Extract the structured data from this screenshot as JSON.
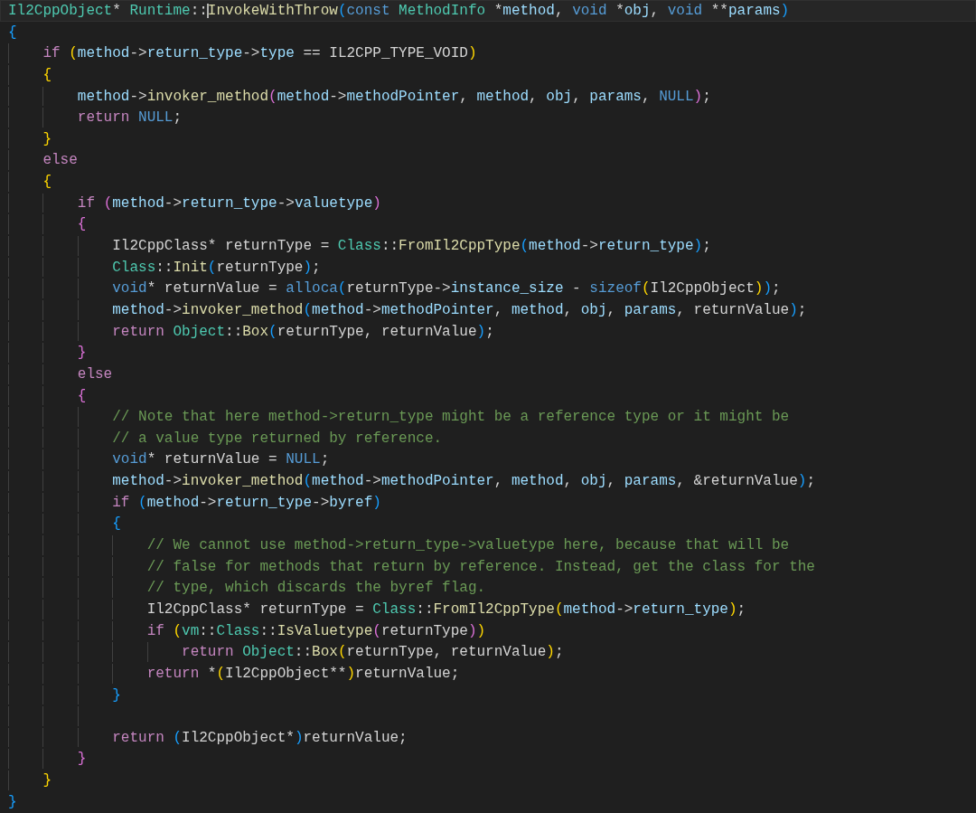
{
  "editor": {
    "lines": [
      {
        "current": true,
        "tokens": [
          {
            "text": "Il2CppObject",
            "kind": "type"
          },
          {
            "text": "* ",
            "kind": "plain"
          },
          {
            "text": "Runtime",
            "kind": "type"
          },
          {
            "text": "::",
            "kind": "plain"
          },
          {
            "text": "InvokeWithThrow",
            "kind": "func",
            "cursor_before": true
          },
          {
            "text": "(",
            "kind": "b0"
          },
          {
            "text": "const ",
            "kind": "storage"
          },
          {
            "text": "MethodInfo",
            "kind": "type"
          },
          {
            "text": " *",
            "kind": "plain"
          },
          {
            "text": "method",
            "kind": "var"
          },
          {
            "text": ", ",
            "kind": "plain"
          },
          {
            "text": "void",
            "kind": "storage"
          },
          {
            "text": " *",
            "kind": "plain"
          },
          {
            "text": "obj",
            "kind": "var"
          },
          {
            "text": ", ",
            "kind": "plain"
          },
          {
            "text": "void",
            "kind": "storage"
          },
          {
            "text": " **",
            "kind": "plain"
          },
          {
            "text": "params",
            "kind": "var"
          },
          {
            "text": ")",
            "kind": "b0"
          }
        ]
      },
      {
        "current": false,
        "tokens": [
          {
            "text": "{",
            "kind": "b0"
          }
        ]
      },
      {
        "current": false,
        "tokens": [
          {
            "text": "    if ",
            "kind": "kw"
          },
          {
            "text": "(",
            "kind": "b1"
          },
          {
            "text": "method",
            "kind": "var"
          },
          {
            "text": "->",
            "kind": "plain"
          },
          {
            "text": "return_type",
            "kind": "var"
          },
          {
            "text": "->",
            "kind": "plain"
          },
          {
            "text": "type",
            "kind": "var"
          },
          {
            "text": " == IL2CPP_TYPE_VOID",
            "kind": "plain"
          },
          {
            "text": ")",
            "kind": "b1"
          }
        ]
      },
      {
        "current": false,
        "tokens": [
          {
            "text": "    {",
            "kind": "b1"
          }
        ]
      },
      {
        "current": false,
        "tokens": [
          {
            "text": "        method",
            "kind": "var"
          },
          {
            "text": "->",
            "kind": "plain"
          },
          {
            "text": "invoker_method",
            "kind": "func"
          },
          {
            "text": "(",
            "kind": "b2"
          },
          {
            "text": "method",
            "kind": "var"
          },
          {
            "text": "->",
            "kind": "plain"
          },
          {
            "text": "methodPointer",
            "kind": "var"
          },
          {
            "text": ", ",
            "kind": "plain"
          },
          {
            "text": "method",
            "kind": "var"
          },
          {
            "text": ", ",
            "kind": "plain"
          },
          {
            "text": "obj",
            "kind": "var"
          },
          {
            "text": ", ",
            "kind": "plain"
          },
          {
            "text": "params",
            "kind": "var"
          },
          {
            "text": ", ",
            "kind": "plain"
          },
          {
            "text": "NULL",
            "kind": "storage"
          },
          {
            "text": ")",
            "kind": "b2"
          },
          {
            "text": ";",
            "kind": "plain"
          }
        ]
      },
      {
        "current": false,
        "tokens": [
          {
            "text": "        return ",
            "kind": "kw"
          },
          {
            "text": "NULL",
            "kind": "storage"
          },
          {
            "text": ";",
            "kind": "plain"
          }
        ]
      },
      {
        "current": false,
        "tokens": [
          {
            "text": "    }",
            "kind": "b1"
          }
        ]
      },
      {
        "current": false,
        "tokens": [
          {
            "text": "    else",
            "kind": "kw"
          }
        ]
      },
      {
        "current": false,
        "tokens": [
          {
            "text": "    {",
            "kind": "b1"
          }
        ]
      },
      {
        "current": false,
        "tokens": [
          {
            "text": "        if ",
            "kind": "kw"
          },
          {
            "text": "(",
            "kind": "b2"
          },
          {
            "text": "method",
            "kind": "var"
          },
          {
            "text": "->",
            "kind": "plain"
          },
          {
            "text": "return_type",
            "kind": "var"
          },
          {
            "text": "->",
            "kind": "plain"
          },
          {
            "text": "valuetype",
            "kind": "var"
          },
          {
            "text": ")",
            "kind": "b2"
          }
        ]
      },
      {
        "current": false,
        "tokens": [
          {
            "text": "        {",
            "kind": "b2"
          }
        ]
      },
      {
        "current": false,
        "tokens": [
          {
            "text": "            Il2CppClass* returnType = ",
            "kind": "plain"
          },
          {
            "text": "Class",
            "kind": "type"
          },
          {
            "text": "::",
            "kind": "plain"
          },
          {
            "text": "FromIl2CppType",
            "kind": "func"
          },
          {
            "text": "(",
            "kind": "b0"
          },
          {
            "text": "method",
            "kind": "var"
          },
          {
            "text": "->",
            "kind": "plain"
          },
          {
            "text": "return_type",
            "kind": "var"
          },
          {
            "text": ")",
            "kind": "b0"
          },
          {
            "text": ";",
            "kind": "plain"
          }
        ]
      },
      {
        "current": false,
        "tokens": [
          {
            "text": "            Class",
            "kind": "type"
          },
          {
            "text": "::",
            "kind": "plain"
          },
          {
            "text": "Init",
            "kind": "func"
          },
          {
            "text": "(",
            "kind": "b0"
          },
          {
            "text": "returnType",
            "kind": "plain"
          },
          {
            "text": ")",
            "kind": "b0"
          },
          {
            "text": ";",
            "kind": "plain"
          }
        ]
      },
      {
        "current": false,
        "tokens": [
          {
            "text": "            void",
            "kind": "storage"
          },
          {
            "text": "* returnValue = ",
            "kind": "plain"
          },
          {
            "text": "alloca",
            "kind": "storage"
          },
          {
            "text": "(",
            "kind": "b0"
          },
          {
            "text": "returnType",
            "kind": "plain"
          },
          {
            "text": "->",
            "kind": "plain"
          },
          {
            "text": "instance_size",
            "kind": "var"
          },
          {
            "text": " - ",
            "kind": "plain"
          },
          {
            "text": "sizeof",
            "kind": "storage"
          },
          {
            "text": "(",
            "kind": "b1"
          },
          {
            "text": "Il2CppObject",
            "kind": "plain"
          },
          {
            "text": ")",
            "kind": "b1"
          },
          {
            "text": ")",
            "kind": "b0"
          },
          {
            "text": ";",
            "kind": "plain"
          }
        ]
      },
      {
        "current": false,
        "tokens": [
          {
            "text": "            method",
            "kind": "var"
          },
          {
            "text": "->",
            "kind": "plain"
          },
          {
            "text": "invoker_method",
            "kind": "func"
          },
          {
            "text": "(",
            "kind": "b0"
          },
          {
            "text": "method",
            "kind": "var"
          },
          {
            "text": "->",
            "kind": "plain"
          },
          {
            "text": "methodPointer",
            "kind": "var"
          },
          {
            "text": ", ",
            "kind": "plain"
          },
          {
            "text": "method",
            "kind": "var"
          },
          {
            "text": ", ",
            "kind": "plain"
          },
          {
            "text": "obj",
            "kind": "var"
          },
          {
            "text": ", ",
            "kind": "plain"
          },
          {
            "text": "params",
            "kind": "var"
          },
          {
            "text": ", returnValue",
            "kind": "plain"
          },
          {
            "text": ")",
            "kind": "b0"
          },
          {
            "text": ";",
            "kind": "plain"
          }
        ]
      },
      {
        "current": false,
        "tokens": [
          {
            "text": "            return ",
            "kind": "kw"
          },
          {
            "text": "Object",
            "kind": "type"
          },
          {
            "text": "::",
            "kind": "plain"
          },
          {
            "text": "Box",
            "kind": "func"
          },
          {
            "text": "(",
            "kind": "b0"
          },
          {
            "text": "returnType, returnValue",
            "kind": "plain"
          },
          {
            "text": ")",
            "kind": "b0"
          },
          {
            "text": ";",
            "kind": "plain"
          }
        ]
      },
      {
        "current": false,
        "tokens": [
          {
            "text": "        }",
            "kind": "b2"
          }
        ]
      },
      {
        "current": false,
        "tokens": [
          {
            "text": "        else",
            "kind": "kw"
          }
        ]
      },
      {
        "current": false,
        "tokens": [
          {
            "text": "        {",
            "kind": "b2"
          }
        ]
      },
      {
        "current": false,
        "tokens": [
          {
            "text": "            // Note that here method->return_type might be a reference type or it might be",
            "kind": "comment"
          }
        ]
      },
      {
        "current": false,
        "tokens": [
          {
            "text": "            // a value type returned by reference.",
            "kind": "comment"
          }
        ]
      },
      {
        "current": false,
        "tokens": [
          {
            "text": "            void",
            "kind": "storage"
          },
          {
            "text": "* returnValue = ",
            "kind": "plain"
          },
          {
            "text": "NULL",
            "kind": "storage"
          },
          {
            "text": ";",
            "kind": "plain"
          }
        ]
      },
      {
        "current": false,
        "tokens": [
          {
            "text": "            method",
            "kind": "var"
          },
          {
            "text": "->",
            "kind": "plain"
          },
          {
            "text": "invoker_method",
            "kind": "func"
          },
          {
            "text": "(",
            "kind": "b0"
          },
          {
            "text": "method",
            "kind": "var"
          },
          {
            "text": "->",
            "kind": "plain"
          },
          {
            "text": "methodPointer",
            "kind": "var"
          },
          {
            "text": ", ",
            "kind": "plain"
          },
          {
            "text": "method",
            "kind": "var"
          },
          {
            "text": ", ",
            "kind": "plain"
          },
          {
            "text": "obj",
            "kind": "var"
          },
          {
            "text": ", ",
            "kind": "plain"
          },
          {
            "text": "params",
            "kind": "var"
          },
          {
            "text": ", &returnValue",
            "kind": "plain"
          },
          {
            "text": ")",
            "kind": "b0"
          },
          {
            "text": ";",
            "kind": "plain"
          }
        ]
      },
      {
        "current": false,
        "tokens": [
          {
            "text": "            if ",
            "kind": "kw"
          },
          {
            "text": "(",
            "kind": "b0"
          },
          {
            "text": "method",
            "kind": "var"
          },
          {
            "text": "->",
            "kind": "plain"
          },
          {
            "text": "return_type",
            "kind": "var"
          },
          {
            "text": "->",
            "kind": "plain"
          },
          {
            "text": "byref",
            "kind": "var"
          },
          {
            "text": ")",
            "kind": "b0"
          }
        ]
      },
      {
        "current": false,
        "tokens": [
          {
            "text": "            {",
            "kind": "b0"
          }
        ]
      },
      {
        "current": false,
        "tokens": [
          {
            "text": "                // We cannot use method->return_type->valuetype here, because that will be",
            "kind": "comment"
          }
        ]
      },
      {
        "current": false,
        "tokens": [
          {
            "text": "                // false for methods that return by reference. Instead, get the class for the",
            "kind": "comment"
          }
        ]
      },
      {
        "current": false,
        "tokens": [
          {
            "text": "                // type, which discards the byref flag.",
            "kind": "comment"
          }
        ]
      },
      {
        "current": false,
        "tokens": [
          {
            "text": "                Il2CppClass* returnType = ",
            "kind": "plain"
          },
          {
            "text": "Class",
            "kind": "type"
          },
          {
            "text": "::",
            "kind": "plain"
          },
          {
            "text": "FromIl2CppType",
            "kind": "func"
          },
          {
            "text": "(",
            "kind": "b1"
          },
          {
            "text": "method",
            "kind": "var"
          },
          {
            "text": "->",
            "kind": "plain"
          },
          {
            "text": "return_type",
            "kind": "var"
          },
          {
            "text": ")",
            "kind": "b1"
          },
          {
            "text": ";",
            "kind": "plain"
          }
        ]
      },
      {
        "current": false,
        "tokens": [
          {
            "text": "                if ",
            "kind": "kw"
          },
          {
            "text": "(",
            "kind": "b1"
          },
          {
            "text": "vm",
            "kind": "type"
          },
          {
            "text": "::",
            "kind": "plain"
          },
          {
            "text": "Class",
            "kind": "type"
          },
          {
            "text": "::",
            "kind": "plain"
          },
          {
            "text": "IsValuetype",
            "kind": "func"
          },
          {
            "text": "(",
            "kind": "b2"
          },
          {
            "text": "returnType",
            "kind": "plain"
          },
          {
            "text": ")",
            "kind": "b2"
          },
          {
            "text": ")",
            "kind": "b1"
          }
        ]
      },
      {
        "current": false,
        "tokens": [
          {
            "text": "                    return ",
            "kind": "kw"
          },
          {
            "text": "Object",
            "kind": "type"
          },
          {
            "text": "::",
            "kind": "plain"
          },
          {
            "text": "Box",
            "kind": "func"
          },
          {
            "text": "(",
            "kind": "b1"
          },
          {
            "text": "returnType, returnValue",
            "kind": "plain"
          },
          {
            "text": ")",
            "kind": "b1"
          },
          {
            "text": ";",
            "kind": "plain"
          }
        ]
      },
      {
        "current": false,
        "tokens": [
          {
            "text": "                return",
            "kind": "kw"
          },
          {
            "text": " *",
            "kind": "plain"
          },
          {
            "text": "(",
            "kind": "b1"
          },
          {
            "text": "Il2CppObject**",
            "kind": "plain"
          },
          {
            "text": ")",
            "kind": "b1"
          },
          {
            "text": "returnValue;",
            "kind": "plain"
          }
        ]
      },
      {
        "current": false,
        "tokens": [
          {
            "text": "            }",
            "kind": "b0"
          }
        ]
      },
      {
        "current": false
      },
      {
        "current": false,
        "tokens": [
          {
            "text": "            return ",
            "kind": "kw"
          },
          {
            "text": "(",
            "kind": "b0"
          },
          {
            "text": "Il2CppObject*",
            "kind": "plain"
          },
          {
            "text": ")",
            "kind": "b0"
          },
          {
            "text": "returnValue;",
            "kind": "plain"
          }
        ]
      },
      {
        "current": false,
        "tokens": [
          {
            "text": "        }",
            "kind": "b2"
          }
        ]
      },
      {
        "current": false,
        "tokens": [
          {
            "text": "    }",
            "kind": "b1"
          }
        ]
      },
      {
        "current": false,
        "tokens": [
          {
            "text": "}",
            "kind": "b0"
          }
        ]
      }
    ]
  }
}
